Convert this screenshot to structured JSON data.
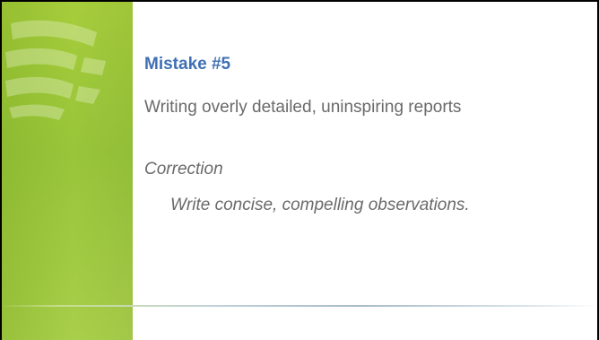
{
  "slide": {
    "title": "Mistake #5",
    "problem": "Writing overly detailed, uninspiring reports",
    "correction_label": "Correction",
    "correction_text": "Write concise, compelling observations.",
    "colors": {
      "title": "#3f6fb4",
      "body_text": "#6a6a6a",
      "band": "#a6cd3b"
    },
    "watermark_icon": "globe-logo-watermark"
  }
}
